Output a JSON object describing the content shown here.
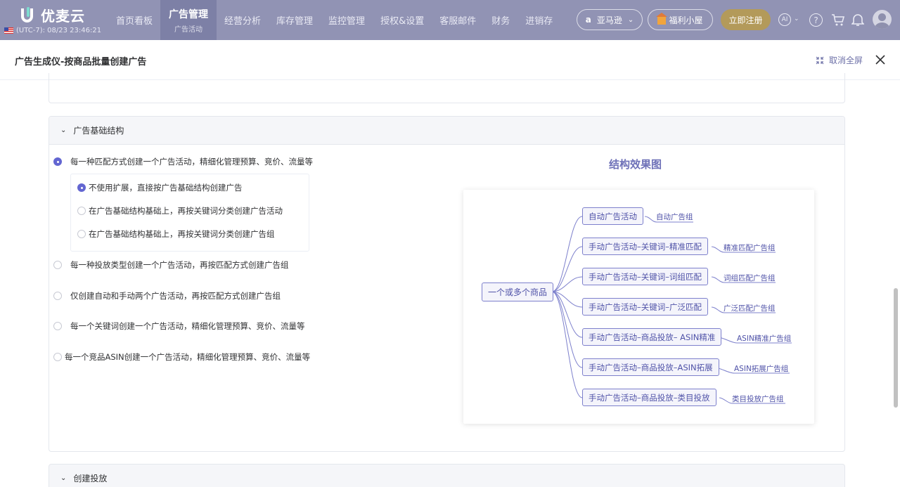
{
  "brand": {
    "name": "优麦云"
  },
  "clock": "(UTC-7): 08/23 23:46:21",
  "nav": {
    "items": [
      {
        "label": "首页看板"
      },
      {
        "label": "广告管理",
        "sub": "广告活动"
      },
      {
        "label": "经营分析"
      },
      {
        "label": "库存管理"
      },
      {
        "label": "监控管理"
      },
      {
        "label": "授权&设置"
      },
      {
        "label": "客服邮件"
      },
      {
        "label": "财务"
      },
      {
        "label": "进销存"
      }
    ]
  },
  "header_actions": {
    "marketplace": "亚马逊",
    "welfare": "福利小屋",
    "register": "立即注册",
    "ai": "AI"
  },
  "dialog": {
    "title": "广告生成仪-按商品批量创建广告",
    "exit_fullscreen": "取消全屏"
  },
  "section": {
    "title": "广告基础结构",
    "options": [
      {
        "label": "每一种匹配方式创建一个广告活动，精细化管理预算、竞价、流量等",
        "selected": true
      },
      {
        "label": "每一种投放类型创建一个广告活动，再按匹配方式创建广告组",
        "selected": false
      },
      {
        "label": "仅创建自动和手动两个广告活动，再按匹配方式创建广告组",
        "selected": false
      },
      {
        "label": "每一个关键词创建一个广告活动，精细化管理预算、竞价、流量等",
        "selected": false
      },
      {
        "label": "每一个竞品ASIN创建一个广告活动，精细化管理预算、竞价、流量等",
        "selected": false
      }
    ],
    "sub_options": [
      {
        "label": "不使用扩展，直接按广告基础结构创建广告",
        "selected": true
      },
      {
        "label": "在广告基础结构基础上，再按关键词分类创建广告活动",
        "selected": false
      },
      {
        "label": "在广告基础结构基础上，再按关键词分类创建广告组",
        "selected": false
      }
    ]
  },
  "diagram": {
    "title": "结构效果图",
    "root": "一个或多个商品",
    "branches": [
      {
        "campaign": "自动广告活动",
        "group": "自动广告组"
      },
      {
        "campaign": "手动广告活动–关键词–精准匹配",
        "group": "精准匹配广告组"
      },
      {
        "campaign": "手动广告活动–关键词–词组匹配",
        "group": "词组匹配广告组"
      },
      {
        "campaign": "手动广告活动–关键词–广泛匹配",
        "group": "广泛匹配广告组"
      },
      {
        "campaign": "手动广告活动–商品投放– ASIN精准",
        "group": "ASIN精准广告组"
      },
      {
        "campaign": "手动广告活动–商品投放–ASIN拓展",
        "group": "ASIN拓展广告组"
      },
      {
        "campaign": "手动广告活动–商品投放–类目投放",
        "group": "类目投放广告组"
      }
    ]
  },
  "section2": {
    "title": "创建投放"
  },
  "colors": {
    "accent": "#6366d1",
    "nav_bg": "#9193b4",
    "node_border": "#7d80cc"
  }
}
